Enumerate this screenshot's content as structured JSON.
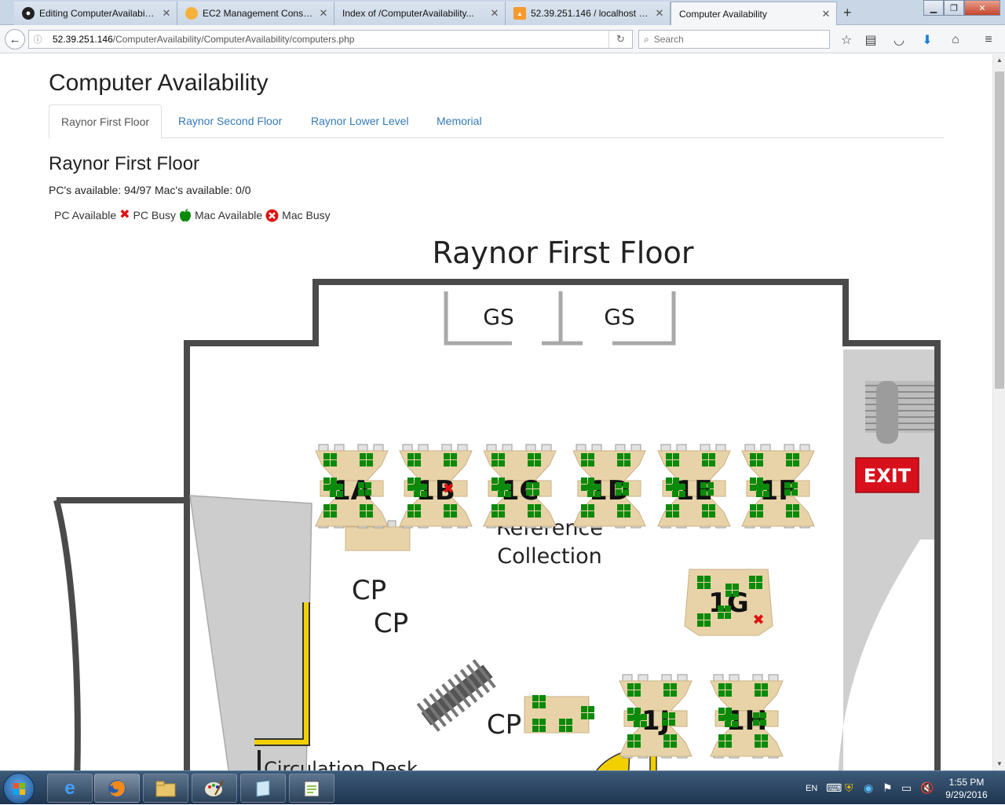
{
  "browser": {
    "tabs": [
      {
        "title": "Editing ComputerAvailabili...",
        "icon": "github-icon",
        "active": false
      },
      {
        "title": "EC2 Management Console",
        "icon": "aws-icon",
        "active": false
      },
      {
        "title": "Index of /ComputerAvailability...",
        "icon": "page-icon",
        "active": false
      },
      {
        "title": "52.39.251.146 / localhost / ...",
        "icon": "phpmyadmin-icon",
        "active": false
      },
      {
        "title": "Computer Availability",
        "icon": "page-icon",
        "active": true
      }
    ],
    "url_host": "52.39.251.146",
    "url_path": "/ComputerAvailability/ComputerAvailability/computers.php",
    "search_placeholder": "Search"
  },
  "page": {
    "app_title": "Computer Availability",
    "tabs": [
      {
        "label": "Raynor First Floor",
        "active": true
      },
      {
        "label": "Raynor Second Floor",
        "active": false
      },
      {
        "label": "Raynor Lower Level",
        "active": false
      },
      {
        "label": "Memorial",
        "active": false
      }
    ],
    "floor_heading": "Raynor First Floor",
    "availability_text": "PC's available: 94/97 Mac's available: 0/0",
    "legend": {
      "pc_available": "PC Available",
      "pc_busy": "PC Busy",
      "mac_available": "Mac Available",
      "mac_busy": "Mac Busy"
    }
  },
  "map": {
    "title": "Raynor First Floor",
    "labels": {
      "gs1": "GS",
      "gs2": "GS",
      "exit": "EXIT",
      "reference_line1": "Reference",
      "reference_line2": "Collection",
      "cp1": "CP",
      "cp2": "CP",
      "cp3": "CP",
      "circulation": "Circulation Desk"
    },
    "clusters": [
      {
        "label": "1A",
        "busy_count": 0
      },
      {
        "label": "1B",
        "busy_count": 1
      },
      {
        "label": "1C",
        "busy_count": 0
      },
      {
        "label": "1D",
        "busy_count": 0
      },
      {
        "label": "1E",
        "busy_count": 0
      },
      {
        "label": "1F",
        "busy_count": 0
      },
      {
        "label": "1G",
        "busy_count": 1
      },
      {
        "label": "1J",
        "busy_count": 0
      },
      {
        "label": "1H",
        "busy_count": 0
      }
    ],
    "colors": {
      "wall": "#4a4a4a",
      "desk": "#e8d3a9",
      "pc_available": "#0a8a0a",
      "pc_busy": "#e01010",
      "exit_sign": "#d8101c",
      "stair_gray": "#c8c8c8",
      "circulation_yellow": "#f2d000"
    }
  },
  "taskbar": {
    "language": "EN",
    "time": "1:55 PM",
    "date": "9/29/2016"
  }
}
